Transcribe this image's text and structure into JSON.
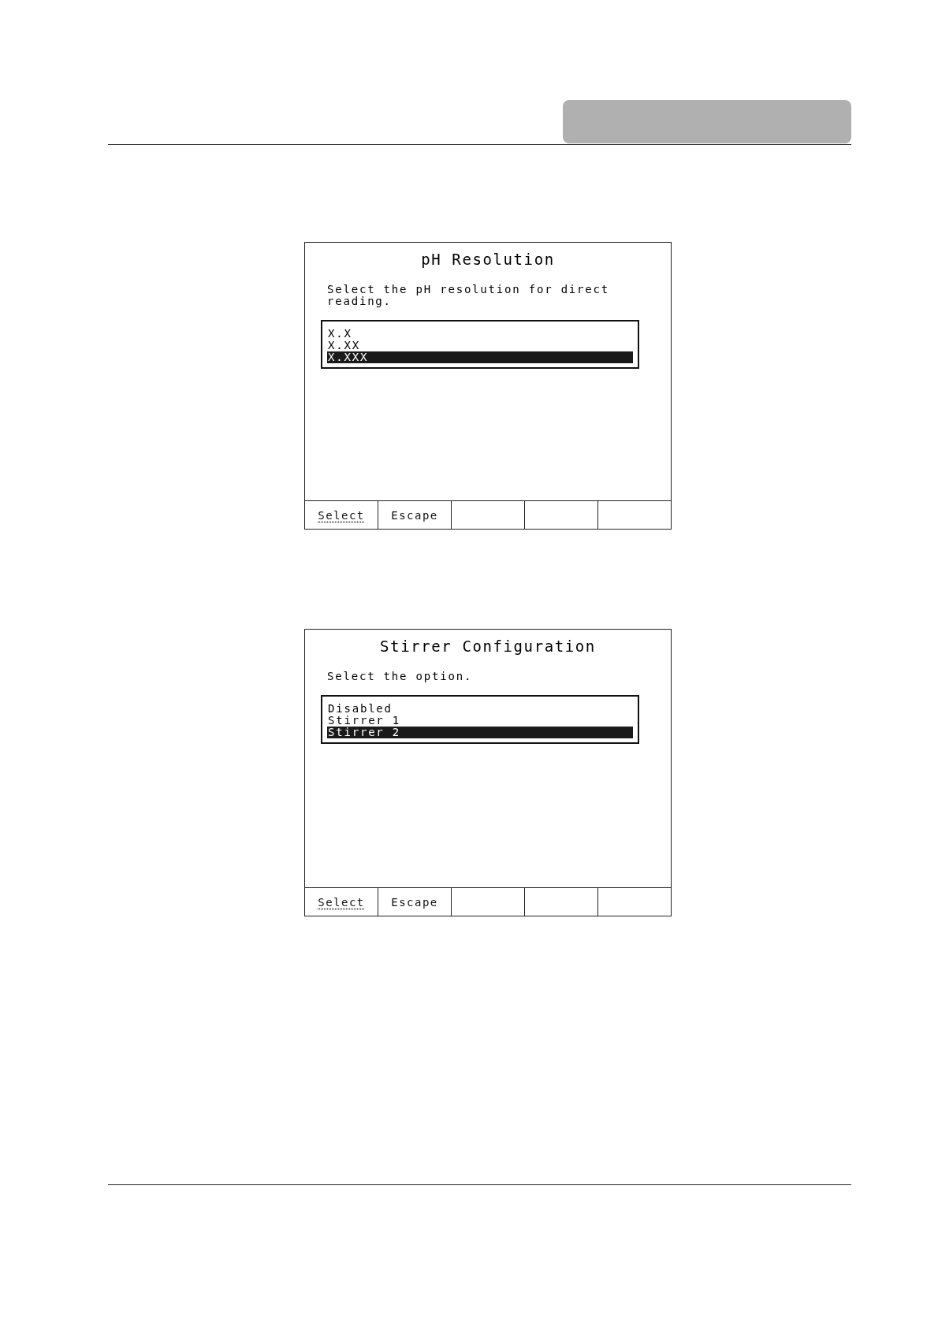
{
  "screens": [
    {
      "title": "pH Resolution",
      "prompt": "Select the pH resolution for direct reading.",
      "options": [
        {
          "label": "X.X",
          "selected": false
        },
        {
          "label": "X.XX",
          "selected": false
        },
        {
          "label": "X.XXX",
          "selected": true
        }
      ],
      "softkeys": [
        {
          "label": "Select",
          "highlighted": true
        },
        {
          "label": "Escape",
          "highlighted": false
        }
      ]
    },
    {
      "title": "Stirrer Configuration",
      "prompt": "Select the option.",
      "options": [
        {
          "label": "Disabled",
          "selected": false
        },
        {
          "label": "Stirrer 1",
          "selected": false
        },
        {
          "label": "Stirrer 2",
          "selected": true
        }
      ],
      "softkeys": [
        {
          "label": "Select",
          "highlighted": true
        },
        {
          "label": "Escape",
          "highlighted": false
        }
      ]
    }
  ]
}
